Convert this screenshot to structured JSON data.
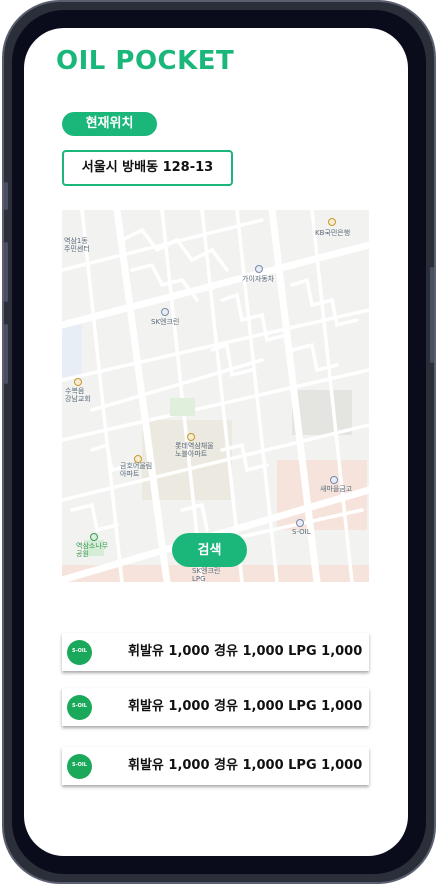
{
  "app": {
    "title": "OIL POCKET"
  },
  "location": {
    "badge_label": "현재위치",
    "address": "서울시 방배동 128-13"
  },
  "map": {
    "labels": {
      "kb_bank": "KB국민은행",
      "jangja": "가이자동차",
      "yeoksam_center": "역삼1동\n주민센터",
      "sk_top": "SK엔크린",
      "church": "수복음\n강남교회",
      "lotte": "롯데역삼채울\n노블아파트",
      "geumho": "금호어울림\n아파트",
      "saemaeul": "새마을금고",
      "soil": "S-OIL",
      "park": "역삼소나무\n공원",
      "sk_bottom": "SK엔크린\nLPG"
    }
  },
  "search": {
    "label": "검색"
  },
  "stations": [
    {
      "brand": "S-OIL",
      "price_text": "휘발유  1,000  경유  1,000  LPG  1,000"
    },
    {
      "brand": "S-OIL",
      "price_text": "휘발유  1,000  경유  1,000  LPG  1,000"
    },
    {
      "brand": "S-OIL",
      "price_text": "휘발유  1,000  경유  1,000  LPG  1,000"
    }
  ],
  "colors": {
    "accent": "#1bb77a",
    "brand_green": "#1aa85a"
  }
}
